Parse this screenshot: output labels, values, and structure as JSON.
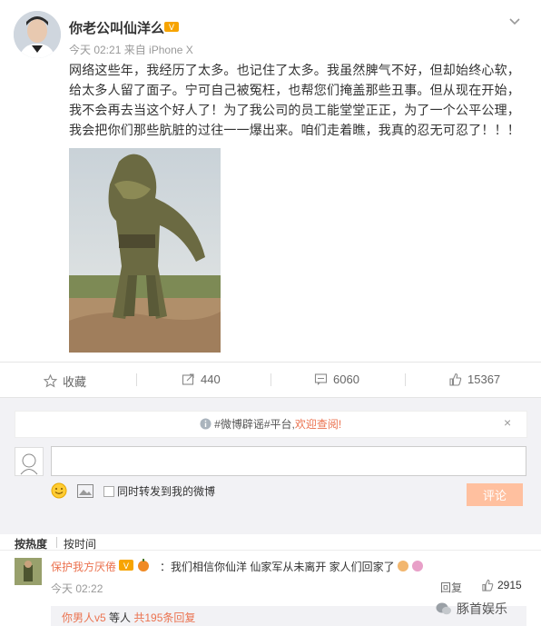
{
  "post": {
    "username": "你老公叫仙洋么",
    "time": "今天 02:21",
    "source": "来自 iPhone X",
    "text": "网络这些年，我经历了太多。也记住了太多。我虽然脾气不好，但却始终心软，给太多人留了面子。宁可自己被冤枉，也帮您们掩盖那些丑事。但从现在开始，我不会再去当这个好人了！为了我公司的员工能堂堂正正，为了一个公平公理，我会把你们那些肮脏的过往一一爆出来。咱们走着瞧，我真的忍无可忍了！！！"
  },
  "actions": {
    "favorite": "收藏",
    "repost": "440",
    "comment": "6060",
    "like": "15367"
  },
  "notice": {
    "prefix": "#微博辟谣#平台,",
    "link": "欢迎查阅!",
    "close": "×"
  },
  "composer": {
    "placeholder": "",
    "repost_label": "同时转发到我的微博",
    "submit_label": "评论"
  },
  "sort": {
    "hot": "按热度",
    "time": "按时间"
  },
  "comment": {
    "name": "保护我方厌倦",
    "text": "：我们相信你仙洋  仙家军从未离开  家人们回家了",
    "time": "今天 02:22",
    "reply": "回复",
    "likes": "2915",
    "sub_user": "你男人v5",
    "sub_mid": " 等人 ",
    "sub_count": "共195条回复"
  },
  "watermark": "豚首娱乐",
  "colors": {
    "accent": "#eb7350",
    "submit": "#ffc09f",
    "link": "#eb7350"
  }
}
